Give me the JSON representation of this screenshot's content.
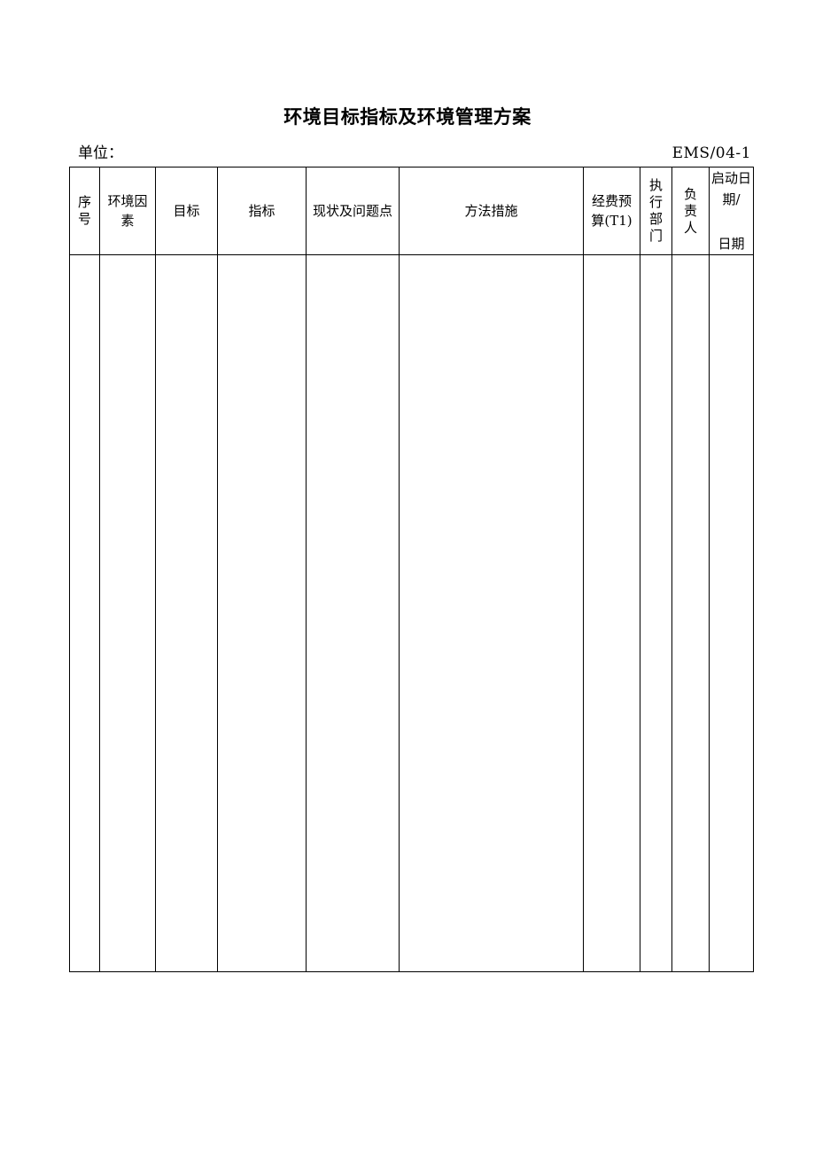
{
  "document": {
    "title": "环境目标指标及环境管理方案",
    "unit_label": "单位：",
    "form_code": "EMS/04-1"
  },
  "table": {
    "columns": [
      {
        "key": "seq",
        "label": "序号",
        "style": "vertical"
      },
      {
        "key": "env_factor",
        "label": "环境因素",
        "style": "wrap"
      },
      {
        "key": "objective",
        "label": "目标",
        "style": "plain"
      },
      {
        "key": "indicator",
        "label": "指标",
        "style": "plain"
      },
      {
        "key": "status",
        "label": "现状及问题点",
        "style": "plain"
      },
      {
        "key": "measures",
        "label": "方法措施",
        "style": "plain"
      },
      {
        "key": "budget",
        "label": "经费预算(T1)",
        "style": "wrap"
      },
      {
        "key": "department",
        "label": "执行部门",
        "style": "vertical"
      },
      {
        "key": "owner",
        "label": "负责人",
        "style": "vertical"
      },
      {
        "key": "dates",
        "label": "启动日期/ 日期",
        "style": "stacked"
      }
    ],
    "header": {
      "seq": "序号",
      "env_factor": "环境因素",
      "objective": "目标",
      "indicator": "指标",
      "status": "现状及问题点",
      "measures": "方法措施",
      "budget": "经费预算(T1)",
      "department": "执行部门",
      "owner": "负责人",
      "date_start": "启动日期/",
      "date_end": "日期"
    },
    "rows": [
      {
        "seq": "",
        "env_factor": "",
        "objective": "",
        "indicator": "",
        "status": "",
        "measures": "",
        "budget": "",
        "department": "",
        "owner": "",
        "dates": ""
      }
    ]
  }
}
